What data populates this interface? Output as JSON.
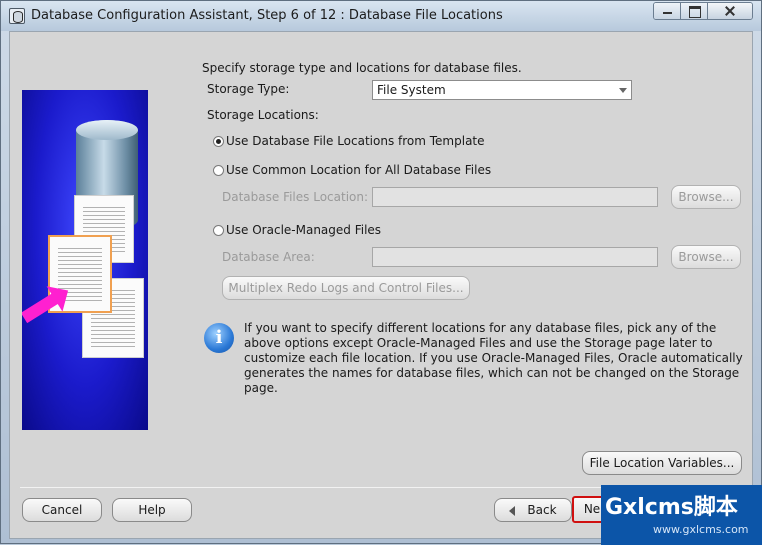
{
  "window": {
    "title": "Database Configuration Assistant, Step 6 of 12 : Database File Locations"
  },
  "content": {
    "intro": "Specify storage type and locations for database files.",
    "storage_type_label": "Storage Type:",
    "storage_type_value": "File System",
    "storage_locations_label": "Storage Locations:",
    "options": [
      {
        "label": "Use Database File Locations from Template",
        "selected": true
      },
      {
        "label": "Use Common Location for All Database Files",
        "selected": false
      },
      {
        "label": "Use Oracle-Managed Files",
        "selected": false
      }
    ],
    "db_files_location_label": "Database Files Location:",
    "db_area_label": "Database Area:",
    "browse_label": "Browse...",
    "multiplex_label": "Multiplex Redo Logs and Control Files...",
    "info_text": "If you want to specify different locations for any database files, pick any of the above options except Oracle-Managed Files and use the Storage page later to customize each file location. If you use Oracle-Managed Files, Oracle automatically generates the names for database files, which can not be changed on the Storage page.",
    "file_location_variables_label": "File Location Variables..."
  },
  "footer": {
    "cancel_label": "Cancel",
    "help_label": "Help",
    "back_label": "Back",
    "next_label": "Ne"
  },
  "watermark": {
    "main": "Gxlcms脚本",
    "sub": "www.gxlcms.com"
  },
  "icons": [
    "app-icon",
    "minimize-icon",
    "maximize-icon",
    "close-icon",
    "dropdown-arrow-icon",
    "info-icon",
    "back-arrow-icon"
  ]
}
